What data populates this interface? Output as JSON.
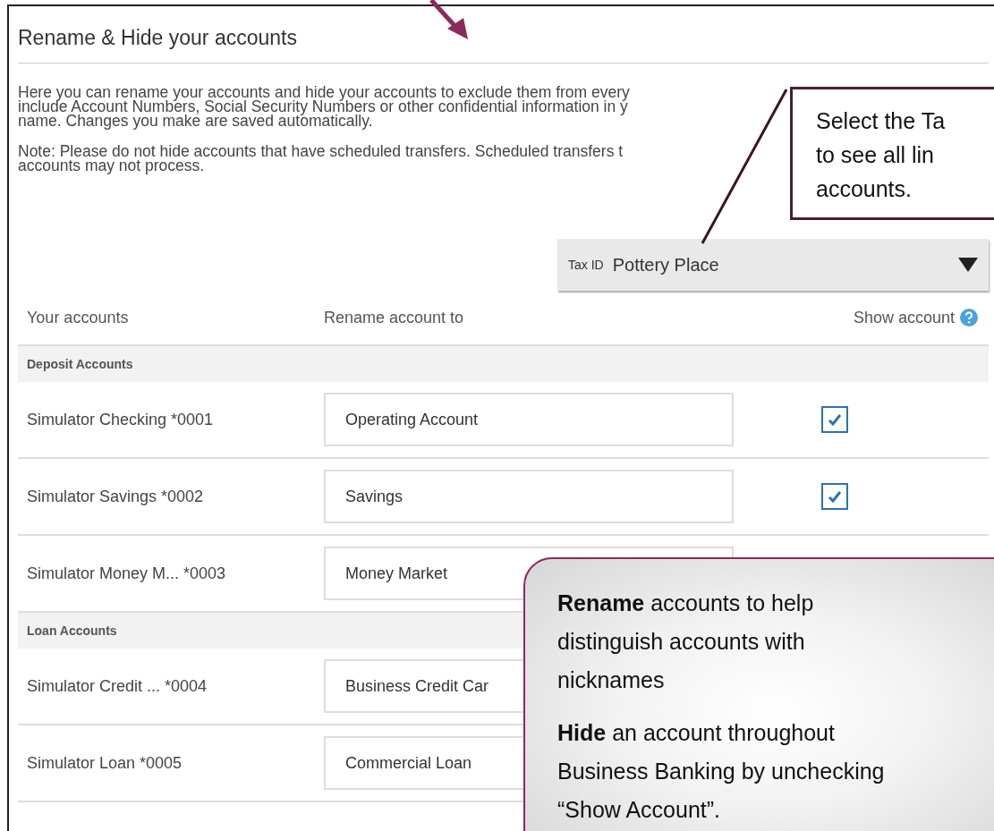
{
  "panel": {
    "title": "Rename & Hide your accounts",
    "intro_lines": [
      "Here you can rename your accounts and hide your accounts to exclude them from every",
      "include Account Numbers, Social Security Numbers or other confidential information in y",
      "name. Changes you make are saved automatically."
    ],
    "note_lines": [
      "Note: Please do not hide accounts that have scheduled transfers. Scheduled transfers t",
      "accounts may not process."
    ],
    "tax_id": {
      "label": "Tax ID",
      "value": "Pottery Place"
    },
    "columns": [
      "Your accounts",
      "Rename account to",
      "Show account"
    ],
    "sections": [
      {
        "title": "Deposit Accounts",
        "rows": [
          {
            "account": "Simulator Checking *0001",
            "rename": "Operating Account",
            "checked": true
          },
          {
            "account": "Simulator Savings *0002",
            "rename": "Savings",
            "checked": true
          },
          {
            "account": "Simulator Money M... *0003",
            "rename": "Money Market"
          }
        ]
      },
      {
        "title": "Loan Accounts",
        "rows": [
          {
            "account": "Simulator Credit ... *0004",
            "rename": "Business Credit Car"
          },
          {
            "account": "Simulator Loan *0005",
            "rename": "Commercial Loan"
          }
        ]
      }
    ]
  },
  "callouts": [
    {
      "kind": "box",
      "lines": [
        "Select the Ta",
        "to see all lin",
        "accounts."
      ]
    },
    {
      "kind": "bubble",
      "paragraphs": [
        "**Rename** accounts to help distinguish accounts with nicknames",
        "**Hide** an account throughout Business Banking by unchecking “Show Account”."
      ]
    }
  ]
}
